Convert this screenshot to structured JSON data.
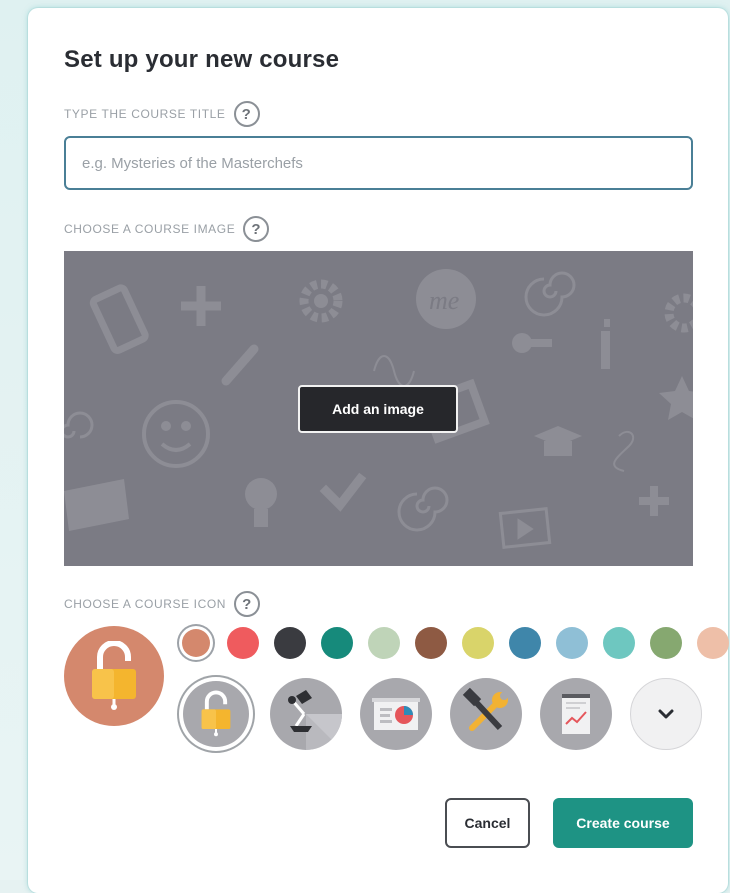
{
  "dialog": {
    "title": "Set up your new course",
    "course_title": {
      "label": "TYPE THE COURSE TITLE",
      "help": "?",
      "value": "",
      "placeholder": "e.g. Mysteries of the Masterchefs"
    },
    "course_image": {
      "label": "CHOOSE A COURSE IMAGE",
      "help": "?",
      "add_image_label": "Add an image",
      "background_icons": [
        "tablet-icon",
        "plus-icon",
        "gear-icon",
        "me-badge-icon",
        "spiral-icon",
        "key-icon",
        "info-icon",
        "pencil-icon",
        "smiley-icon",
        "envelope-icon",
        "lightbulb-icon",
        "checkmark-icon",
        "graduation-cap-icon",
        "star-icon",
        "video-icon"
      ],
      "me_badge_text": "me"
    },
    "course_icon": {
      "label": "CHOOSE A COURSE ICON",
      "help": "?",
      "selected_color": "#d4886d",
      "selected_icon": "padlock-icon",
      "colors": [
        "#d4886d",
        "#ef5b5e",
        "#3a3b40",
        "#168a7b",
        "#bfd4b8",
        "#8e5a43",
        "#d9d46a",
        "#3f86aa",
        "#8fbfd6",
        "#6ec7c0",
        "#86a870",
        "#eebfa8"
      ],
      "icons": [
        "padlock-icon",
        "desk-lamp-icon",
        "presentation-chart-icon",
        "tools-icon",
        "report-document-icon"
      ],
      "more_icon": "chevron-down-icon"
    },
    "actions": {
      "cancel_label": "Cancel",
      "create_label": "Create course"
    }
  }
}
